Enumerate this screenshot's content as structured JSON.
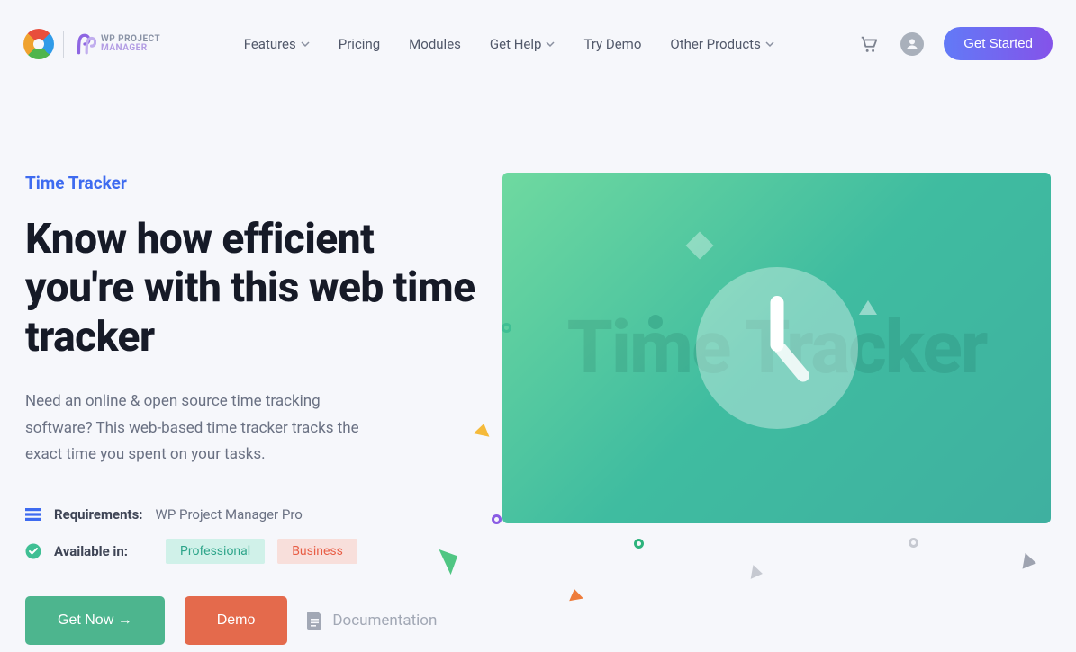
{
  "brand": {
    "line1": "WP PROJECT",
    "line2": "MANAGER"
  },
  "nav": {
    "features": "Features",
    "pricing": "Pricing",
    "modules": "Modules",
    "get_help": "Get Help",
    "try_demo": "Try Demo",
    "other_products": "Other Products"
  },
  "header": {
    "cta": "Get Started"
  },
  "hero": {
    "eyebrow": "Time Tracker",
    "heading": "Know how efficient you're with this web time tracker",
    "subheading": "Need an online & open source time tracking software? This web-based time tracker tracks the exact time you spent on your tasks.",
    "illustration_text": "Time Tracker"
  },
  "meta": {
    "requirements_label": "Requirements:",
    "requirements_value": "WP Project Manager Pro",
    "available_label": "Available in:",
    "plans": {
      "professional": "Professional",
      "business": "Business"
    }
  },
  "buttons": {
    "get_now": "Get Now →",
    "demo": "Demo",
    "documentation": "Documentation"
  }
}
